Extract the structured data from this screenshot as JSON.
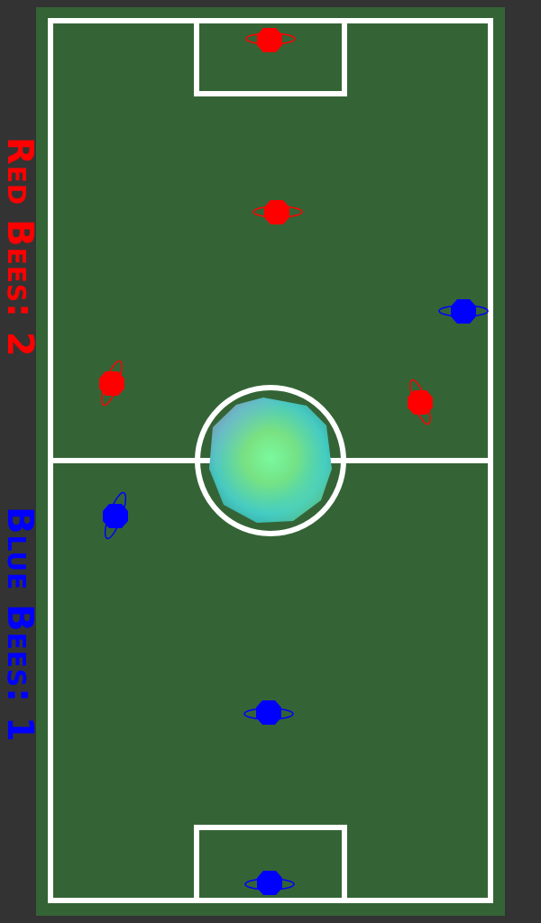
{
  "scoreboard": {
    "red_label": "Red Bees: 2",
    "blue_label": "Blue Bees: 1"
  },
  "colors": {
    "background": "#333333",
    "pitch": "#346436",
    "lines": "#ffffff",
    "red_team": "#ff0000",
    "blue_team": "#0000ff"
  },
  "pieces": {
    "ball": "multicolor-ball",
    "red_team": [
      "red-bee",
      "red-bee",
      "red-bee",
      "red-bee"
    ],
    "blue_team": [
      "blue-bee",
      "blue-bee",
      "blue-bee",
      "blue-bee"
    ]
  }
}
